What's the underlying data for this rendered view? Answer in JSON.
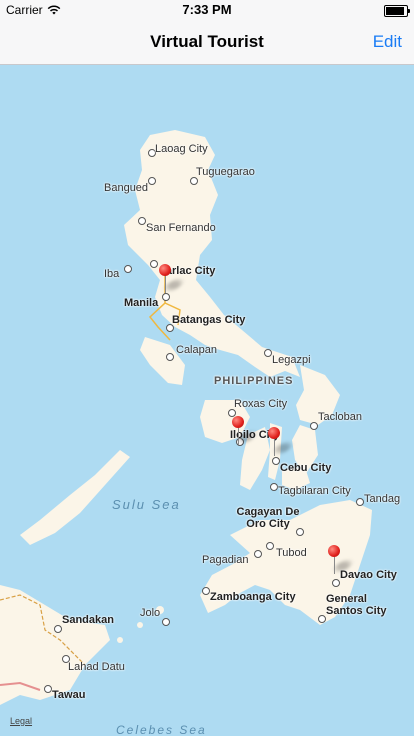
{
  "status_bar": {
    "carrier": "Carrier",
    "time": "7:33 PM",
    "battery_level": 1.0
  },
  "nav": {
    "title": "Virtual Tourist",
    "edit_label": "Edit"
  },
  "map": {
    "country": "PHILIPPINES",
    "sea": "Sulu Sea",
    "legal": "Legal",
    "cities": {
      "laoag": "Laoag City",
      "tuguegarao": "Tuguegarao",
      "bangued": "Bangued",
      "san_fernando": "San Fernando",
      "iba": "Iba",
      "tarlac": "Tarlac City",
      "manila": "Manila",
      "batangas": "Batangas City",
      "calapan": "Calapan",
      "legazpi": "Legazpi",
      "roxas": "Roxas City",
      "tacloban": "Tacloban",
      "iloilo": "Iloilo City",
      "cebu": "Cebu City",
      "tagbilaran": "Tagbilaran City",
      "tandag": "Tandag",
      "cagayan": "Cagayan De Oro City",
      "pagadian": "Pagadian",
      "tubod": "Tubod",
      "davao": "Davao City",
      "zamboanga": "Zamboanga City",
      "gensan": "General Santos City",
      "sandakan": "Sandakan",
      "jolo": "Jolo",
      "lahad_datu": "Lahad Datu",
      "tawau": "Tawau",
      "celebes": "Celebes Sea"
    }
  }
}
